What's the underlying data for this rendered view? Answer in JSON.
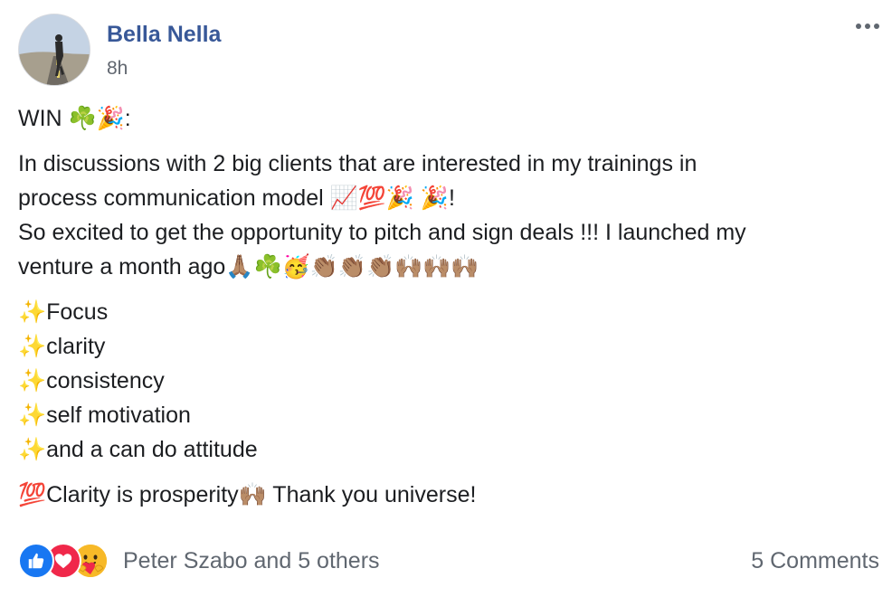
{
  "post": {
    "author": "Bella Nella",
    "timestamp": "8h",
    "more_icon": "more-horizontal-icon",
    "paragraphs": [
      [
        "WIN ☘️🎉:"
      ],
      [
        "In discussions with 2 big clients that are interested in my trainings in",
        "process communication model 📈💯🎉 🎉!",
        "So excited to get the opportunity to pitch and sign deals !!! I launched my",
        "venture a month ago🙏🏽☘️🥳👏🏽👏🏽👏🏽🙌🏽🙌🏽🙌🏽"
      ],
      [
        "✨Focus",
        "✨clarity",
        "✨consistency",
        "✨self motivation",
        "✨and a can do attitude"
      ],
      [
        "💯Clarity is prosperity🙌🏽 Thank you universe!"
      ]
    ]
  },
  "footer": {
    "reactions": [
      "like-icon",
      "love-icon",
      "care-icon"
    ],
    "reactors_text": "Peter Szabo and 5 others",
    "comments_text": "5 Comments"
  },
  "colors": {
    "author": "#385898",
    "meta": "#616770",
    "like": "#1877f2",
    "love": "#f0284a",
    "care": "#f7b928"
  }
}
